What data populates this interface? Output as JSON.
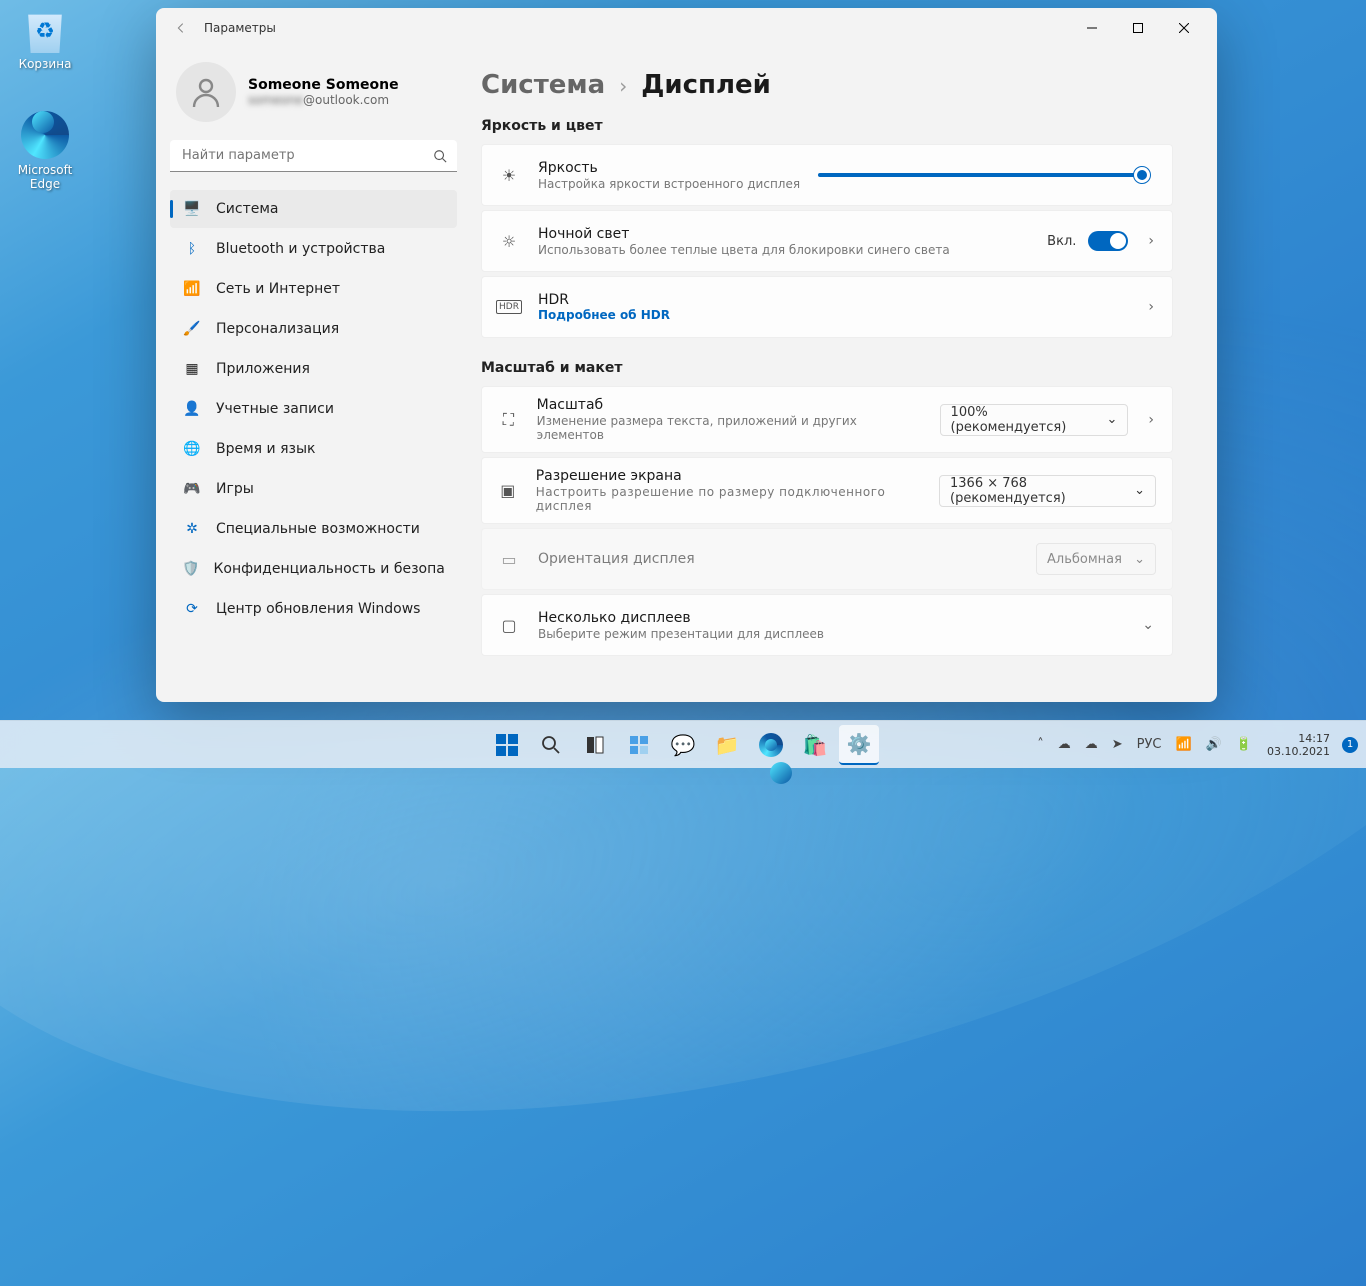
{
  "desktop": {
    "recycle_bin": "Корзина",
    "edge": "Microsoft Edge"
  },
  "window": {
    "app_title": "Параметры",
    "account_name": "Someone Someone",
    "account_email_prefix": "someone",
    "account_email_suffix": "@outlook.com",
    "search_placeholder": "Найти параметр"
  },
  "sidebar": [
    {
      "label": "Система"
    },
    {
      "label": "Bluetooth и устройства"
    },
    {
      "label": "Сеть и Интернет"
    },
    {
      "label": "Персонализация"
    },
    {
      "label": "Приложения"
    },
    {
      "label": "Учетные записи"
    },
    {
      "label": "Время и язык"
    },
    {
      "label": "Игры"
    },
    {
      "label": "Специальные возможности"
    },
    {
      "label": "Конфиденциальность и безопасность"
    },
    {
      "label": "Центр обновления Windows"
    }
  ],
  "breadcrumb": {
    "parent": "Система",
    "current": "Дисплей"
  },
  "sections": {
    "brightness_color": "Яркость и цвет",
    "scale_layout": "Масштаб и макет"
  },
  "cards": {
    "brightness": {
      "title": "Яркость",
      "sub": "Настройка яркости встроенного дисплея"
    },
    "night_light": {
      "title": "Ночной свет",
      "sub": "Использовать более теплые цвета для блокировки синего света",
      "state": "Вкл."
    },
    "hdr": {
      "title": "HDR",
      "link": "Подробнее об HDR"
    },
    "scale": {
      "title": "Масштаб",
      "sub": "Изменение размера текста, приложений и других элементов",
      "value": "100% (рекомендуется)"
    },
    "resolution": {
      "title": "Разрешение экрана",
      "sub": "Настроить разрешение по размеру подключенного дисплея",
      "value": "1366 × 768 (рекомендуется)"
    },
    "orientation": {
      "title": "Ориентация дисплея",
      "value": "Альбомная"
    },
    "multi": {
      "title": "Несколько дисплеев",
      "sub": "Выберите режим презентации для дисплеев"
    }
  },
  "taskbar": {
    "lang": "РУС",
    "time": "14:17",
    "date": "03.10.2021",
    "notif": "1"
  }
}
